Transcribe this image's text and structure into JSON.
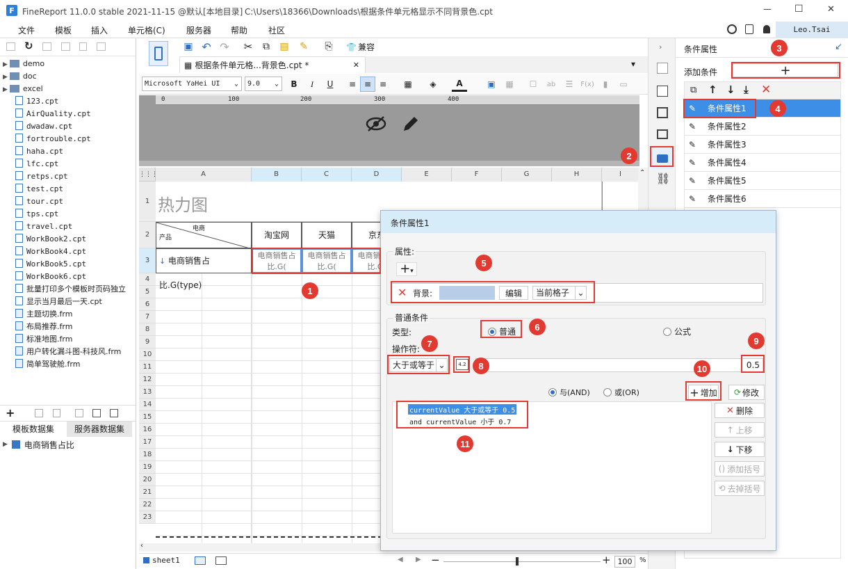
{
  "window": {
    "app": "FineReport 11.0.0 stable 2021-11-15 @默认[本地目录]",
    "path": "C:\\Users\\18366\\Downloads\\根据条件单元格显示不同背景色.cpt",
    "minimize": "—",
    "maximize": "☐",
    "close": "✕"
  },
  "menu": [
    "文件",
    "模板",
    "插入",
    "单元格(C)",
    "服务器",
    "帮助",
    "社区"
  ],
  "user": "Leo.Tsai",
  "tree": [
    "demo",
    "doc",
    "excel",
    "123.cpt",
    "AirQuality.cpt",
    "dwadaw.cpt",
    "fortrouble.cpt",
    "haha.cpt",
    "lfc.cpt",
    "retps.cpt",
    "test.cpt",
    "tour.cpt",
    "tps.cpt",
    "travel.cpt",
    "WorkBook2.cpt",
    "WorkBook4.cpt",
    "WorkBook5.cpt",
    "WorkBook6.cpt",
    "批量打印多个模板时页码独立",
    "显示当月最后一天.cpt",
    "主题切换.frm",
    "布局推荐.frm",
    "标准地图.frm",
    "用户转化漏斗图-科技风.frm",
    "简单驾驶舱.frm"
  ],
  "dataset_tabs": [
    "模板数据集",
    "服务器数据集"
  ],
  "dataset_item": "电商销售占比",
  "editor": {
    "tab_title": "根据条件单元格...背景色.cpt *",
    "compat_label": "兼容",
    "font_name": "Microsoft YaHei UI",
    "font_size": "9.0",
    "ruler": [
      "0",
      "100",
      "200",
      "300",
      "400"
    ],
    "columns": [
      "A",
      "B",
      "C",
      "D",
      "E",
      "F",
      "G",
      "H",
      "I"
    ],
    "rows": [
      "1",
      "2",
      "3",
      "4",
      "5",
      "6",
      "7",
      "8",
      "9",
      "10",
      "11",
      "12",
      "13",
      "14",
      "15",
      "16",
      "17",
      "18",
      "19",
      "20",
      "21",
      "22",
      "23"
    ],
    "title_cell": "热力图",
    "header_top": "电商",
    "header_bottom": "产品",
    "col_b": "淘宝网",
    "col_c": "天猫",
    "col_d": "京东",
    "row3_a": "电商销售占比.G(type)",
    "row3_vals": [
      "电商销售占比.G(",
      "电商销售占比.G(",
      "电商销售占比.G("
    ],
    "sheet": "sheet1",
    "zoom": "100",
    "zoom_unit": "%"
  },
  "rpanel": {
    "title": "条件属性",
    "add_label": "添加条件",
    "items": [
      "条件属性1",
      "条件属性2",
      "条件属性3",
      "条件属性4",
      "条件属性5",
      "条件属性6"
    ]
  },
  "dialog": {
    "title": "条件属性1",
    "section_prop": "属性:",
    "bg_label": "背景:",
    "edit_btn": "编辑",
    "scope_value": "当前格子",
    "section_cond": "普通条件",
    "type_label": "类型:",
    "type_normal": "普通",
    "type_formula": "公式",
    "op_label": "操作符:",
    "op_value": "大于或等于",
    "operand_value": "0.5",
    "and_label": "与(AND)",
    "or_label": "或(OR)",
    "add_btn": "增加",
    "modify_btn": "修改",
    "conditions": [
      "currentValue 大于或等于 0.5",
      "and currentValue 小于 0.7"
    ],
    "delete_btn": "删除",
    "up_btn": "上移",
    "down_btn": "下移",
    "add_bracket_btn": "添加括号",
    "remove_bracket_btn": "去掉括号"
  },
  "badges": [
    "1",
    "2",
    "3",
    "4",
    "5",
    "6",
    "7",
    "8",
    "9",
    "10",
    "11"
  ],
  "colors": {
    "accent": "#3d8ee6",
    "selected": "#3d8ee6",
    "badge": "#e23a31",
    "bg_swatch": "#b8cde8",
    "header_bg": "#d6ecf8"
  }
}
